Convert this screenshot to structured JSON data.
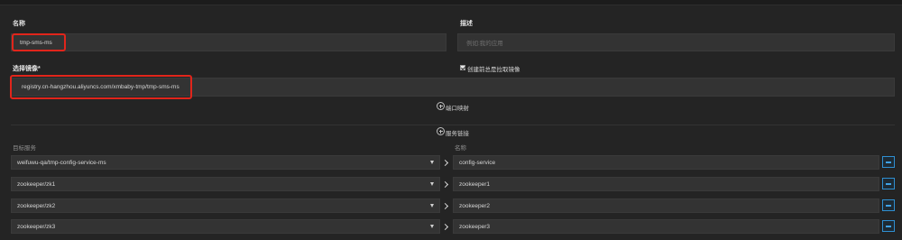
{
  "form": {
    "name_label": "名称",
    "name_value": "tmp-sms-ms",
    "description_label": "描述",
    "description_placeholder": "例如:我的应用",
    "image_label": "选择镜像*",
    "image_value": "registry.cn-hangzhou.aliyuncs.com/xmbaby-tmp/tmp-sms-ms",
    "pull_checkbox_label": "创建前总是拉取镜像",
    "pull_checked": true
  },
  "sections": {
    "port_mapping": "端口映射",
    "service_link": "服务链接"
  },
  "links": {
    "target_header": "目标服务",
    "name_header": "名称",
    "rows": [
      {
        "target": "weifuwu-qa/tmp-config-service-ms",
        "name": "config-service"
      },
      {
        "target": "zookeeper/zk1",
        "name": "zookeeper1"
      },
      {
        "target": "zookeeper/zk2",
        "name": "zookeeper2"
      },
      {
        "target": "zookeeper/zk3",
        "name": "zookeeper3"
      }
    ]
  },
  "colors": {
    "background": "#242424",
    "input_background": "#333333",
    "highlight_red": "#e1251b",
    "remove_button_blue": "#2f8fd1"
  },
  "icons": {
    "add": "plus-circle-icon",
    "caret": "caret-down-icon",
    "arrow": "chevron-right-icon",
    "remove": "minus-icon"
  }
}
